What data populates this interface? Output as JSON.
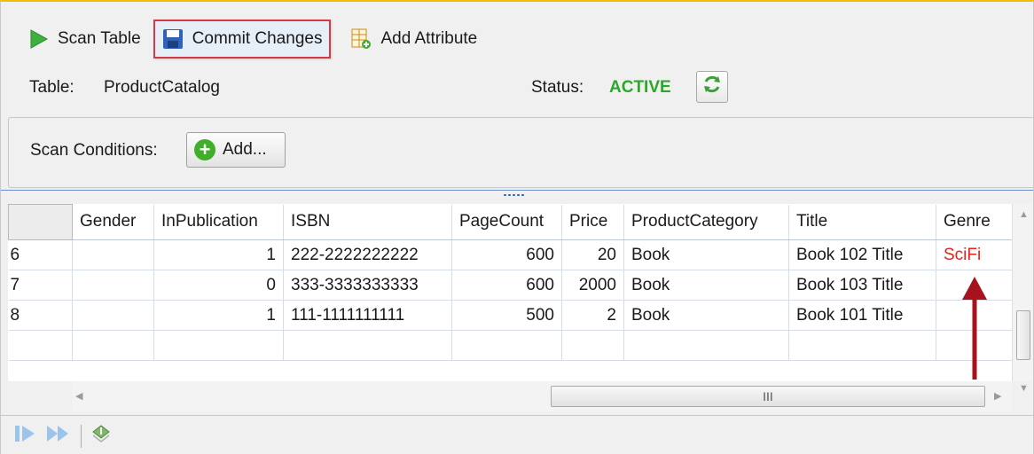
{
  "toolbar": {
    "scan_table": "Scan Table",
    "commit_changes": "Commit Changes",
    "add_attribute": "Add Attribute"
  },
  "info": {
    "table_label": "Table:",
    "table_name": "ProductCatalog",
    "status_label": "Status:",
    "status_value": "ACTIVE"
  },
  "scan_conditions": {
    "label": "Scan Conditions:",
    "add_button": "Add..."
  },
  "grid": {
    "columns": [
      "",
      "Gender",
      "InPublication",
      "ISBN",
      "PageCount",
      "Price",
      "ProductCategory",
      "Title",
      "Genre"
    ],
    "rows": [
      {
        "id": "6",
        "gender": "",
        "inpublication": "1",
        "isbn": "222-2222222222",
        "pagecount": "600",
        "price": "20",
        "category": "Book",
        "title": "Book 102 Title",
        "genre": "SciFi"
      },
      {
        "id": "7",
        "gender": "",
        "inpublication": "0",
        "isbn": "333-3333333333",
        "pagecount": "600",
        "price": "2000",
        "category": "Book",
        "title": "Book 103 Title",
        "genre": ""
      },
      {
        "id": "8",
        "gender": "",
        "inpublication": "1",
        "isbn": "111-1111111111",
        "pagecount": "500",
        "price": "2",
        "category": "Book",
        "title": "Book 101 Title",
        "genre": ""
      }
    ]
  },
  "hscroll_thumb": "III",
  "colors": {
    "status_active": "#2aa82a",
    "highlight_border": "#d43a45",
    "genre_text": "#e8211f",
    "annotation_arrow": "#a8121c"
  },
  "icons": {
    "scan_table": "play-icon",
    "commit_changes": "save-icon",
    "add_attribute": "add-column-icon",
    "refresh": "refresh-icon",
    "add": "plus-icon"
  }
}
